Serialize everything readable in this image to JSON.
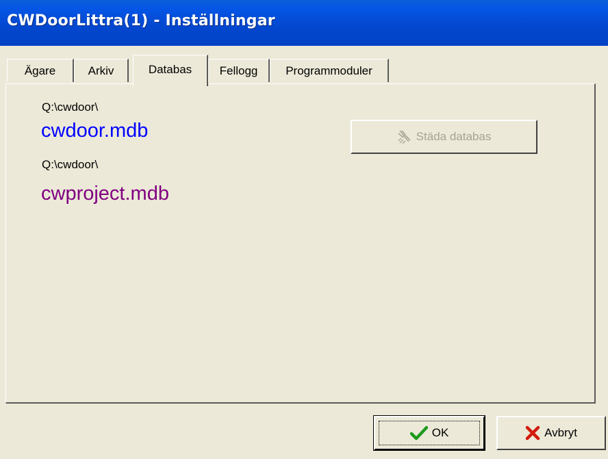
{
  "window": {
    "title": "CWDoorLittra(1) - Inställningar"
  },
  "tabs": [
    {
      "label": "Ägare",
      "active": false
    },
    {
      "label": "Arkiv",
      "active": false
    },
    {
      "label": "Databas",
      "active": true
    },
    {
      "label": "Fellogg",
      "active": false
    },
    {
      "label": "Programmoduler",
      "active": false
    }
  ],
  "databas": {
    "db1": {
      "path": "Q:\\cwdoor\\",
      "name": "cwdoor.mdb"
    },
    "db2": {
      "path": "Q:\\cwdoor\\",
      "name": "cwproject.mdb"
    },
    "clean_button": {
      "label": "Städa databas",
      "icon": "broom-icon",
      "enabled": false
    }
  },
  "footer": {
    "ok_label": "OK",
    "ok_icon": "checkmark-icon",
    "cancel_label": "Avbryt",
    "cancel_icon": "x-mark-icon"
  },
  "colors": {
    "titlebar": "#0348d0",
    "db1_name": "#0000ff",
    "db2_name": "#800080",
    "ok_check": "#1e9a1e",
    "cancel_x": "#d21a0e",
    "disabled_text": "#a6a395"
  }
}
